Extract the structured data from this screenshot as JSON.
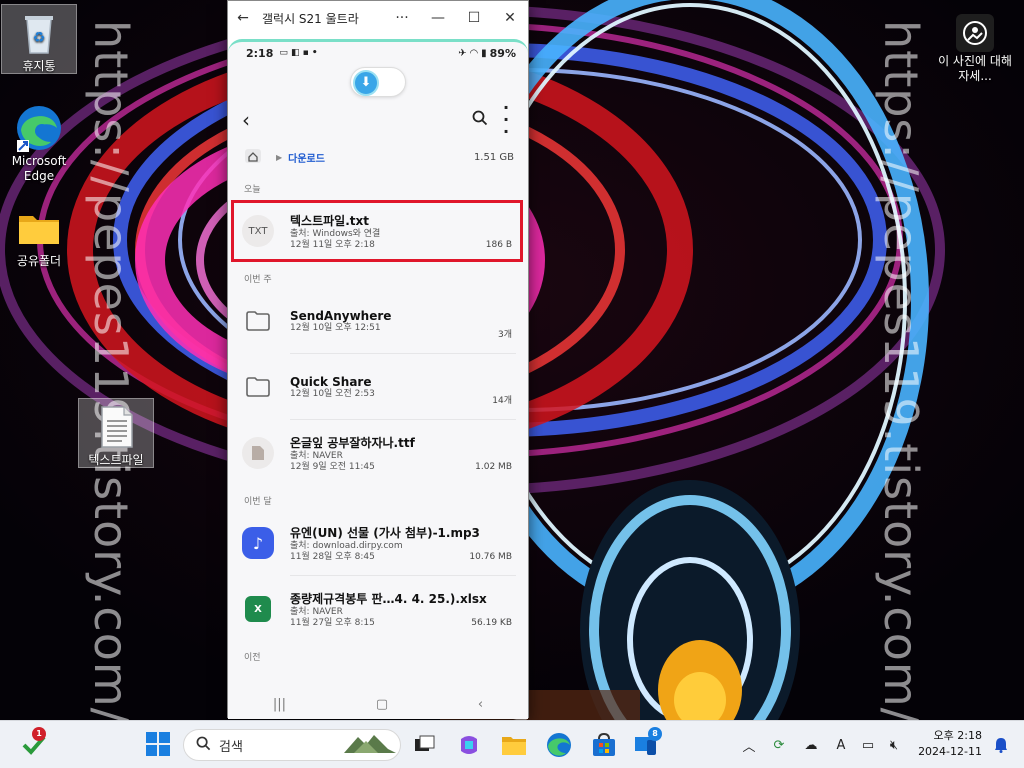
{
  "watermark": {
    "text": "https://pepes119.tistory.com/"
  },
  "desktop": {
    "icons": [
      {
        "label": "휴지통",
        "icon": "recycle-bin-icon"
      },
      {
        "label": "Microsoft Edge",
        "icon": "edge-icon"
      },
      {
        "label": "공유폴더",
        "icon": "folder-icon"
      },
      {
        "label": "텍스트파일",
        "icon": "text-file-icon"
      }
    ],
    "spotlight_label": "이 사진에 대해 자세..."
  },
  "phone_window": {
    "title": "갤럭시 S21 울트라",
    "more_label": "···",
    "status": {
      "time": "2:18",
      "battery": "89%"
    },
    "path": {
      "folder": "다운로드",
      "size": "1.51 GB"
    },
    "sections": {
      "today": "오늘",
      "this_week": "이번 주",
      "this_month": "이번 달",
      "earlier": "이전"
    },
    "files": [
      {
        "icon_label": "TXT",
        "name": "텍스트파일.txt",
        "source": "출처: Windows와 연결",
        "date": "12월 11일 오후 2:18",
        "size": "186 B"
      },
      {
        "name": "SendAnywhere",
        "date": "12월 10일 오후 12:51",
        "size": "3개"
      },
      {
        "name": "Quick Share",
        "date": "12월 10일 오전 2:53",
        "size": "14개"
      },
      {
        "name": "온글잎 공부잘하자나.ttf",
        "source": "출처: NAVER",
        "date": "12월 9일 오전 11:45",
        "size": "1.02 MB"
      },
      {
        "name": "유엔(UN) 선물 (가사 첨부)-1.mp3",
        "source": "출처: download.dirpy.com",
        "date": "11월 28일 오후 8:45",
        "size": "10.76 MB"
      },
      {
        "name": "종량제규격봉투 판…4. 4. 25.).xlsx",
        "source": "출처: NAVER",
        "date": "11월 27일 오후 8:15",
        "size": "56.19 KB"
      }
    ]
  },
  "taskbar": {
    "search_placeholder": "검색",
    "badge_security": "1",
    "badge_phone": "8",
    "clock_time": "오후 2:18",
    "clock_date": "2024-12-11",
    "tray_input": "A"
  }
}
